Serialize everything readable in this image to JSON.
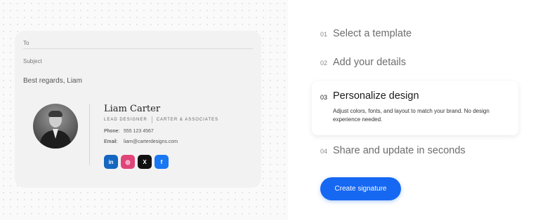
{
  "email_preview": {
    "to_label": "To",
    "subject_label": "Subject",
    "closing": "Best regards, Liam"
  },
  "signature": {
    "name": "Liam Carter",
    "title": "LEAD DESIGNER",
    "company": "CARTER & ASSOCIATES",
    "phone_label": "Phone:",
    "phone": "555 123 4567",
    "email_label": "Email:",
    "email": "liam@carterdesigns.com",
    "socials": [
      {
        "icon": "linkedin-icon",
        "glyph": "in"
      },
      {
        "icon": "instagram-icon",
        "glyph": "◎"
      },
      {
        "icon": "x-icon",
        "glyph": "X"
      },
      {
        "icon": "facebook-icon",
        "glyph": "f"
      }
    ]
  },
  "steps": [
    {
      "num": "01",
      "title": "Select a template"
    },
    {
      "num": "02",
      "title": "Add your details"
    },
    {
      "num": "03",
      "title": "Personalize design",
      "description": "Adjust colors, fonts, and layout to match your brand. No design experience needed.",
      "active": true
    },
    {
      "num": "04",
      "title": "Share and update in seconds"
    }
  ],
  "cta": {
    "label": "Create signature"
  },
  "colors": {
    "accent": "#1668f2",
    "linkedin": "#1466c0",
    "instagram": "#e0457a",
    "x": "#111111",
    "facebook": "#1877f2"
  }
}
